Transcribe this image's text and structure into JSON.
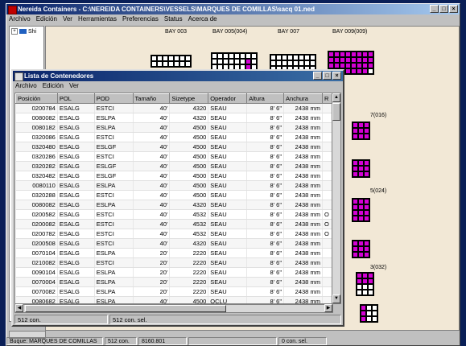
{
  "main": {
    "title": "Nereida Containers - C:\\NEREIDA CONTAINERS\\VESSELS\\MARQUES DE COMILLAS\\sacq 01.ned",
    "menu": [
      "Archivo",
      "Edición",
      "Ver",
      "Herramientas",
      "Preferencias",
      "Status",
      "Acerca de"
    ],
    "tree_node": "Shi",
    "bays": [
      "BAY 003",
      "BAY 005(004)",
      "BAY 007",
      "BAY 009(009)"
    ],
    "side_labels": [
      "7(016)",
      "5(024)",
      "3(032)"
    ],
    "status": [
      "Buque: MARQUES DE COMILLAS",
      "512 con.",
      "8160.801",
      "",
      "0 con. sel."
    ]
  },
  "list": {
    "title": "Lista de Contenedores",
    "menu": [
      "Archivo",
      "Edición",
      "Ver"
    ],
    "columns": [
      "Posición",
      "POL",
      "POD",
      "Tamaño",
      "Sizetype",
      "Operador",
      "Altura",
      "Anchura",
      "R"
    ],
    "rows": [
      [
        "0200784",
        "ESALG",
        "ESTCI",
        "40'",
        "4320",
        "SEAU",
        "8' 6\"",
        "2438 mm",
        ""
      ],
      [
        "0080082",
        "ESALG",
        "ESLPA",
        "40'",
        "4320",
        "SEAU",
        "8' 6\"",
        "2438 mm",
        ""
      ],
      [
        "0080182",
        "ESALG",
        "ESLPA",
        "40'",
        "4500",
        "SEAU",
        "8' 6\"",
        "2438 mm",
        ""
      ],
      [
        "0320086",
        "ESALG",
        "ESTCI",
        "40'",
        "4500",
        "SEAU",
        "8' 6\"",
        "2438 mm",
        ""
      ],
      [
        "0320480",
        "ESALG",
        "ESLGF",
        "40'",
        "4500",
        "SEAU",
        "8' 6\"",
        "2438 mm",
        ""
      ],
      [
        "0320286",
        "ESALG",
        "ESTCI",
        "40'",
        "4500",
        "SEAU",
        "8' 6\"",
        "2438 mm",
        ""
      ],
      [
        "0320282",
        "ESALG",
        "ESLGF",
        "40'",
        "4500",
        "SEAU",
        "8' 6\"",
        "2438 mm",
        ""
      ],
      [
        "0320482",
        "ESALG",
        "ESLGF",
        "40'",
        "4500",
        "SEAU",
        "8' 6\"",
        "2438 mm",
        ""
      ],
      [
        "0080110",
        "ESALG",
        "ESLPA",
        "40'",
        "4500",
        "SEAU",
        "8' 6\"",
        "2438 mm",
        ""
      ],
      [
        "0320288",
        "ESALG",
        "ESTCI",
        "40'",
        "4500",
        "SEAU",
        "8' 6\"",
        "2438 mm",
        ""
      ],
      [
        "0080082",
        "ESALG",
        "ESLPA",
        "40'",
        "4320",
        "SEAU",
        "8' 6\"",
        "2438 mm",
        ""
      ],
      [
        "0200582",
        "ESALG",
        "ESTCI",
        "40'",
        "4532",
        "SEAU",
        "8' 6\"",
        "2438 mm",
        "O"
      ],
      [
        "0200082",
        "ESALG",
        "ESTCI",
        "40'",
        "4532",
        "SEAU",
        "8' 6\"",
        "2438 mm",
        "O"
      ],
      [
        "0200782",
        "ESALG",
        "ESTCI",
        "40'",
        "4532",
        "SEAU",
        "8' 6\"",
        "2438 mm",
        "O"
      ],
      [
        "0200508",
        "ESALG",
        "ESTCI",
        "40'",
        "4320",
        "SEAU",
        "8' 6\"",
        "2438 mm",
        ""
      ],
      [
        "0070104",
        "ESALG",
        "ESLPA",
        "20'",
        "2220",
        "SEAU",
        "8' 6\"",
        "2438 mm",
        ""
      ],
      [
        "0210082",
        "ESALG",
        "ESTCI",
        "20'",
        "2220",
        "SEAU",
        "8' 6\"",
        "2438 mm",
        ""
      ],
      [
        "0090104",
        "ESALG",
        "ESLPA",
        "20'",
        "2220",
        "SEAU",
        "8' 6\"",
        "2438 mm",
        ""
      ],
      [
        "0070004",
        "ESALG",
        "ESLPA",
        "20'",
        "2220",
        "SEAU",
        "8' 6\"",
        "2438 mm",
        ""
      ],
      [
        "0070082",
        "ESALG",
        "ESLPA",
        "20'",
        "2220",
        "SEAU",
        "8' 6\"",
        "2438 mm",
        ""
      ],
      [
        "0080682",
        "ESALG",
        "ESLPA",
        "40'",
        "4500",
        "OCLU",
        "8' 6\"",
        "2438 mm",
        ""
      ]
    ],
    "status_count": "512 con.",
    "status_sel": "512 con. sel."
  }
}
